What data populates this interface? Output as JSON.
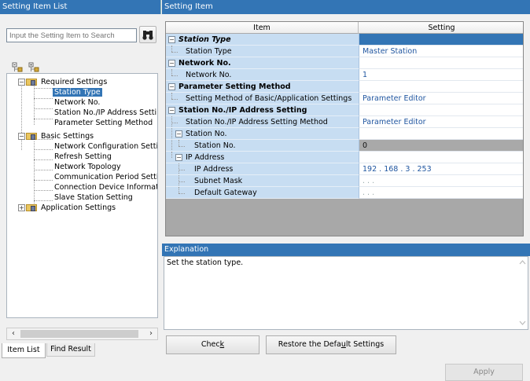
{
  "left_panel": {
    "title": "Setting Item List",
    "search_placeholder": "Input the Setting Item to Search",
    "tree": {
      "required": "Required Settings",
      "station_type": "Station Type",
      "network_no": "Network No.",
      "station_ip": "Station No./IP Address Setti",
      "param_method": "Parameter Setting Method",
      "basic": "Basic Settings",
      "net_config": "Network Configuration Settin",
      "refresh": "Refresh Setting",
      "topology": "Network Topology",
      "comm_period": "Communication Period Settin",
      "conn_device": "Connection Device Informatic",
      "slave_station": "Slave Station Setting",
      "application": "Application Settings"
    },
    "tabs": {
      "item_list": "Item List",
      "find_result": "Find Result"
    }
  },
  "right_panel": {
    "title": "Setting Item",
    "columns": {
      "item": "Item",
      "setting": "Setting"
    },
    "rows": {
      "r0": {
        "item": "Station Type",
        "setting": ""
      },
      "r1": {
        "item": "Station Type",
        "setting": "Master Station"
      },
      "r2": {
        "item": "Network No.",
        "setting": ""
      },
      "r3": {
        "item": "Network No.",
        "setting": "1"
      },
      "r4": {
        "item": "Parameter Setting Method",
        "setting": ""
      },
      "r5": {
        "item": "Setting Method of Basic/Application Settings",
        "setting": "Parameter Editor"
      },
      "r6": {
        "item": "Station No./IP Address Setting",
        "setting": ""
      },
      "r7": {
        "item": "Station No./IP Address Setting Method",
        "setting": "Parameter Editor"
      },
      "r8": {
        "item": "Station No.",
        "setting": ""
      },
      "r9": {
        "item": "Station No.",
        "setting": "0"
      },
      "r10": {
        "item": "IP Address",
        "setting": ""
      },
      "r11": {
        "item": "IP Address",
        "setting": "192 . 168 .   3 . 253"
      },
      "r12": {
        "item": "Subnet Mask",
        "setting": "   .      .      ."
      },
      "r13": {
        "item": "Default Gateway",
        "setting": "   .      .      ."
      }
    },
    "explanation": {
      "title": "Explanation",
      "text": "Set the station type."
    },
    "buttons": {
      "check": "Chec",
      "check_accel": "k",
      "restore_pre": "Restore the Defa",
      "restore_accel": "u",
      "restore_post": "lt Settings",
      "apply": "Apply"
    }
  },
  "colors": {
    "header_blue": "#3375b5",
    "item_cell": "#c7ddf2",
    "value_text": "#2056a0"
  }
}
